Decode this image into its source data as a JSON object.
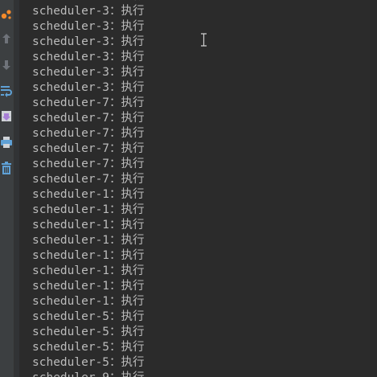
{
  "toolbar": {
    "icons": [
      "run-orange-icon",
      "scroll-up-icon",
      "scroll-down-icon",
      "soft-wrap-icon",
      "scroll-to-end-icon",
      "print-icon",
      "clear-trash-icon"
    ]
  },
  "console": {
    "lines": [
      "scheduler-3：执行",
      "scheduler-3：执行",
      "scheduler-3：执行",
      "scheduler-3：执行",
      "scheduler-3：执行",
      "scheduler-3：执行",
      "scheduler-3：执行",
      "scheduler-7：执行",
      "scheduler-7：执行",
      "scheduler-7：执行",
      "scheduler-7：执行",
      "scheduler-7：执行",
      "scheduler-7：执行",
      "scheduler-1：执行",
      "scheduler-1：执行",
      "scheduler-1：执行",
      "scheduler-1：执行",
      "scheduler-1：执行",
      "scheduler-1：执行",
      "scheduler-1：执行",
      "scheduler-1：执行",
      "scheduler-5：执行",
      "scheduler-5：执行",
      "scheduler-5：执行",
      "scheduler-5：执行",
      "scheduler-9：执行"
    ]
  },
  "colors": {
    "background": "#2b2b2b",
    "toolbar": "#3c3f41",
    "text": "#bbbbbb",
    "accent_orange": "#f48a2a",
    "icon_blue": "#5fa1d6",
    "icon_purple": "#a77fd6",
    "icon_gray": "#6f737a"
  }
}
